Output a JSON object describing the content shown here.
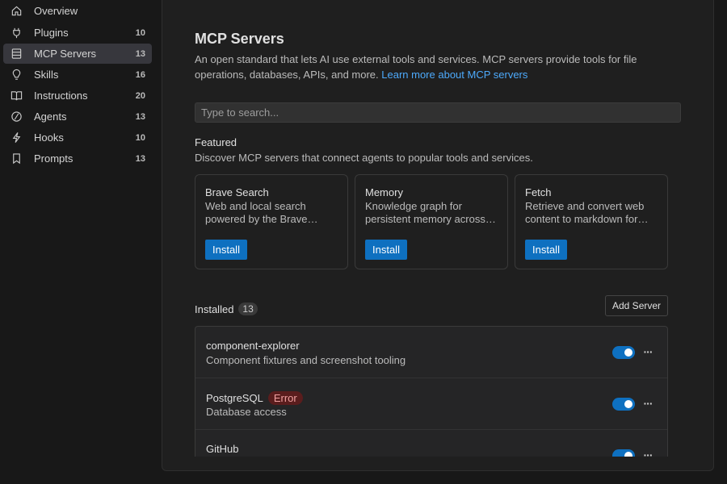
{
  "sidebar": {
    "items": [
      {
        "label": "Overview",
        "count": "",
        "icon": "home-icon"
      },
      {
        "label": "Plugins",
        "count": "10",
        "icon": "plug-icon"
      },
      {
        "label": "MCP Servers",
        "count": "13",
        "icon": "server-icon",
        "active": true
      },
      {
        "label": "Skills",
        "count": "16",
        "icon": "lightbulb-icon"
      },
      {
        "label": "Instructions",
        "count": "20",
        "icon": "book-icon"
      },
      {
        "label": "Agents",
        "count": "13",
        "icon": "agent-icon"
      },
      {
        "label": "Hooks",
        "count": "10",
        "icon": "lightning-icon"
      },
      {
        "label": "Prompts",
        "count": "13",
        "icon": "bookmark-icon"
      }
    ]
  },
  "main": {
    "title": "MCP Servers",
    "description": "An open standard that lets AI use external tools and services. MCP servers provide tools for file operations, databases, APIs, and more. ",
    "learn_more": "Learn more about MCP servers",
    "search_placeholder": "Type to search...",
    "featured": {
      "title": "Featured",
      "description": "Discover MCP servers that connect agents to popular tools and services.",
      "cards": [
        {
          "name": "Brave Search",
          "desc": "Web and local search powered by the Brave Search API",
          "button": "Install"
        },
        {
          "name": "Memory",
          "desc": "Knowledge graph for persistent memory across sessions",
          "button": "Install"
        },
        {
          "name": "Fetch",
          "desc": "Retrieve and convert web content to markdown for agents",
          "button": "Install"
        }
      ]
    },
    "installed": {
      "title": "Installed",
      "count": "13",
      "add_button": "Add Server",
      "servers": [
        {
          "name": "component-explorer",
          "desc": "Component fixtures and screenshot tooling",
          "status": "",
          "enabled": true
        },
        {
          "name": "PostgreSQL",
          "desc": "Database access",
          "status": "Error",
          "enabled": true
        },
        {
          "name": "GitHub",
          "desc": "",
          "status": "",
          "enabled": true
        }
      ]
    }
  },
  "colors": {
    "accent": "#0e70c0",
    "link": "#4daafc",
    "error_bg": "#5a1d1d"
  }
}
